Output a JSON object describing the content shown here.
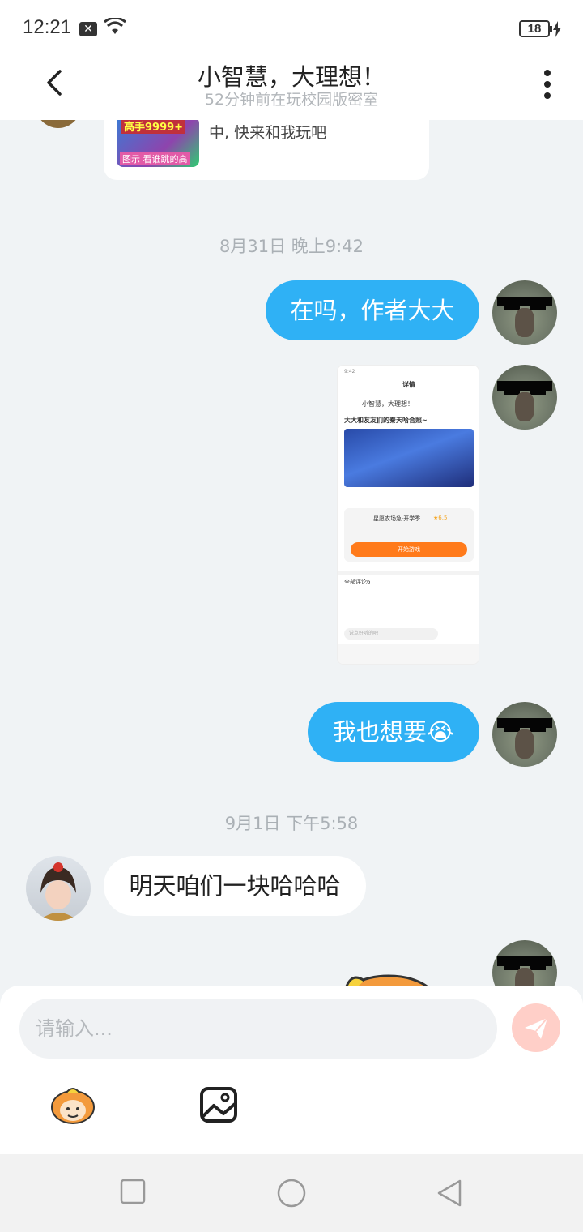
{
  "status_bar": {
    "time": "12:21",
    "notification_icon": "close-box-icon",
    "wifi_icon": "wifi-icon",
    "battery": "18",
    "charging_icon": "bolt-icon"
  },
  "header": {
    "title": "小智慧，大理想！",
    "subtitle": "52分钟前在玩校园版密室",
    "back_icon": "chevron-left-icon",
    "menu_icon": "more-vertical-icon"
  },
  "chat": {
    "invite": {
      "thumb_tag": "高手9999+",
      "thumb_tag2": "图示 看谁跳的高",
      "text": "我正在开学跳跳跳-超级派对中, 快来和我玩吧"
    },
    "timestamp_1": "8月31日 晚上9:42",
    "msg_1": "在吗，作者大大",
    "screenshot": {
      "time": "9:42",
      "header_label": "详情",
      "author": "小智慧，大理想！",
      "caption": "大大和友友们的秦天哈合照~",
      "game_name": "星愿农场急·开学季",
      "game_rating": "★6.5",
      "play_button": "开始游戏",
      "comments_label": "全部评论6",
      "input_placeholder": "说点好听的吧"
    },
    "msg_2": "我也想要😭",
    "timestamp_2": "9月1日 下午5:58",
    "msg_3": "明天咱们一块哈哈哈"
  },
  "input_area": {
    "placeholder": "请输入...",
    "send_icon": "send-icon",
    "emoji_icon": "monkey-emoji-icon",
    "image_icon": "image-icon"
  },
  "nav_bar": {
    "recents_icon": "square-icon",
    "home_icon": "circle-icon",
    "back_icon": "triangle-back-icon"
  },
  "colors": {
    "accent_bubble": "#2fb1f5",
    "send_button": "#ffb6ac"
  }
}
